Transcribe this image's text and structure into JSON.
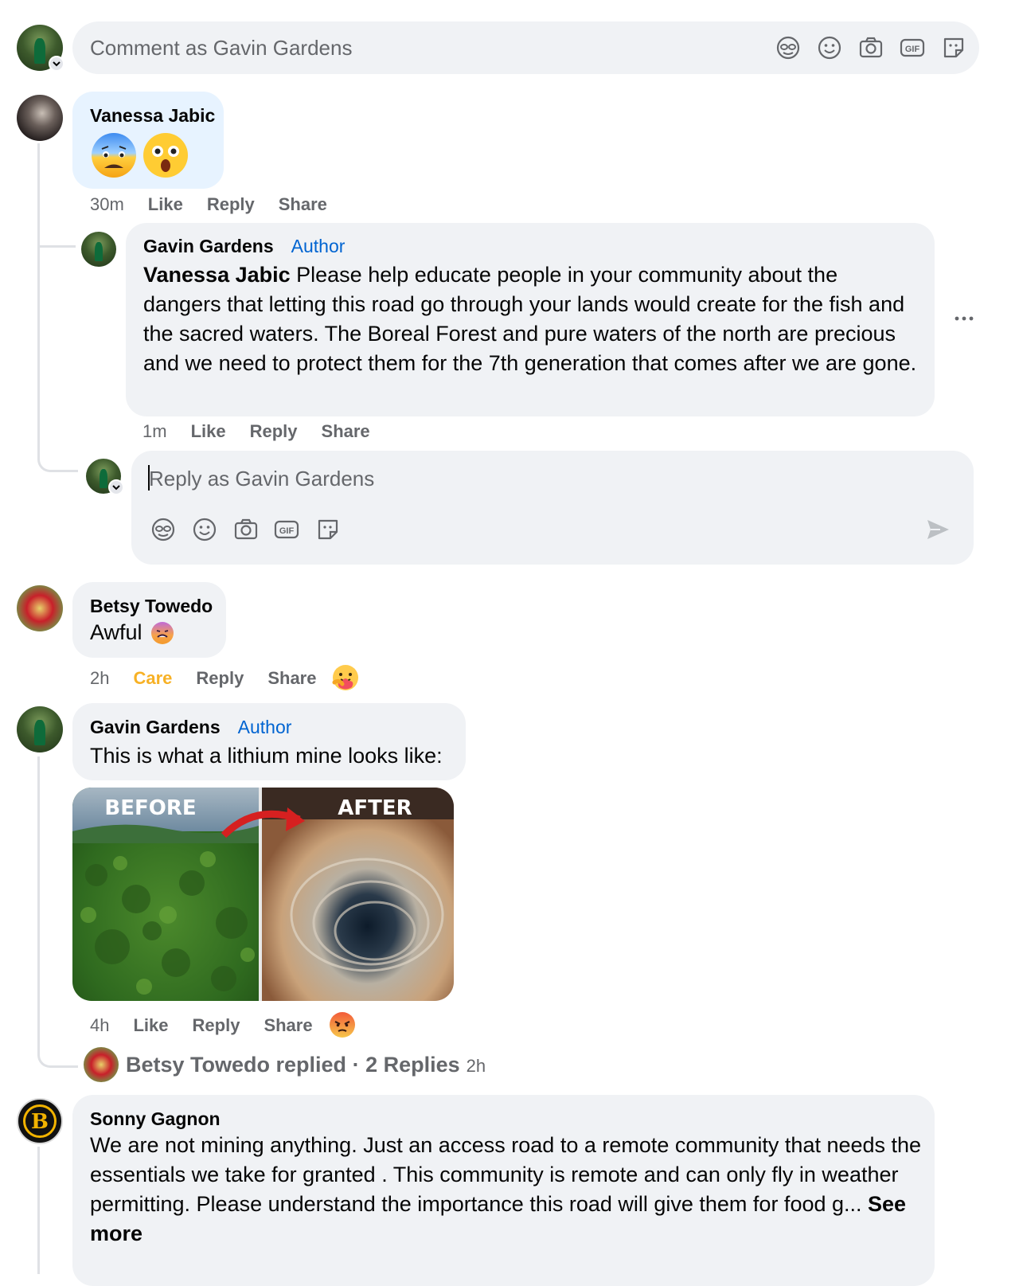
{
  "composer": {
    "placeholder": "Comment as Gavin Gardens",
    "icons": [
      "avatar-sticker-icon",
      "emoji-icon",
      "camera-icon",
      "gif-icon",
      "sticker-icon"
    ]
  },
  "comments": [
    {
      "author": "Vanessa Jabic",
      "emojis": [
        "anxious-face",
        "astonished-face"
      ],
      "time": "30m",
      "actions": {
        "like": "Like",
        "reply": "Reply",
        "share": "Share"
      },
      "reply": {
        "author": "Gavin Gardens",
        "badge": "Author",
        "mention": "Vanessa Jabic",
        "text": " Please help educate people in your community about the dangers that letting this road go through your lands would create for the fish and the sacred waters. The Boreal Forest and pure waters of the north are precious and we need to protect them for the 7th generation that comes after we are gone.",
        "time": "1m",
        "actions": {
          "like": "Like",
          "reply": "Reply",
          "share": "Share"
        }
      },
      "reply_box": {
        "placeholder": "Reply as Gavin Gardens"
      }
    },
    {
      "author": "Betsy Towedo",
      "text": "Awful",
      "time": "2h",
      "actions": {
        "care": "Care",
        "reply": "Reply",
        "share": "Share"
      }
    },
    {
      "author": "Gavin Gardens",
      "badge": "Author",
      "text": "This is what a lithium mine looks like:",
      "image": {
        "before_label": "BEFORE",
        "after_label": "AFTER"
      },
      "time": "4h",
      "actions": {
        "like": "Like",
        "reply": "Reply",
        "share": "Share"
      },
      "replies_summary": {
        "name": "Betsy Towedo replied",
        "sep": " · ",
        "count": "2 Replies",
        "time": "2h"
      }
    },
    {
      "author": "Sonny Gagnon",
      "text": "We are not mining anything. Just an access road to a remote community that needs the essentials we take for granted . This community is remote and can only fly in weather permitting. Please understand the importance this road will give them for food g...",
      "see_more": "See more"
    }
  ],
  "colors": {
    "bubble": "#f0f2f5",
    "highlight_bubble": "#e7f3ff",
    "author_blue": "#0064d1",
    "care_orange": "#f7b125",
    "meta_gray": "#65676b"
  }
}
